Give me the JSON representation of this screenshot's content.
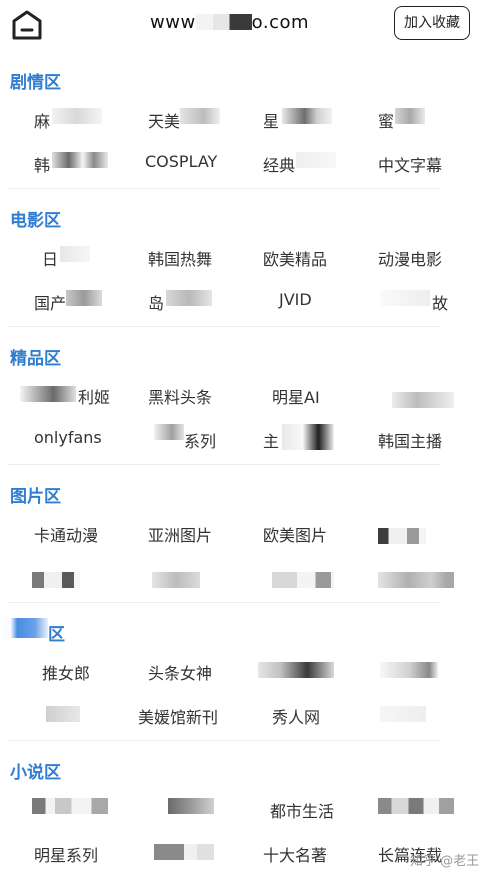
{
  "header": {
    "home_icon": "home-icon",
    "url_prefix": "www",
    "url_suffix": "o.com",
    "fav_button": "加入收藏"
  },
  "sections": [
    {
      "title": "剧情区",
      "items": [
        "麻",
        "天美",
        "星",
        "蜜",
        "韩",
        "COSPLAY",
        "经典",
        "中文字幕"
      ]
    },
    {
      "title": "电影区",
      "items": [
        "日",
        "韩国热舞",
        "欧美精品",
        "动漫电影",
        "国产",
        "岛",
        "JVID",
        "故"
      ]
    },
    {
      "title": "精品区",
      "items": [
        "利姬",
        "黑料头条",
        "明星AI",
        "",
        "onlyfans",
        "系列",
        "主",
        "韩国主播"
      ]
    },
    {
      "title": "图片区",
      "items": [
        "卡通动漫",
        "亚洲图片",
        "欧美图片",
        "",
        "",
        "",
        "",
        ""
      ]
    },
    {
      "title": "区",
      "items": [
        "推女郎",
        "头条女神",
        "",
        "",
        "",
        "美媛馆新刊",
        "秀人网",
        ""
      ]
    },
    {
      "title": "小说区",
      "items": [
        "",
        "",
        "都市生活",
        "",
        "明星系列",
        "",
        "十大名著",
        "长篇连载"
      ]
    }
  ],
  "watermark": "知乎 @老王"
}
